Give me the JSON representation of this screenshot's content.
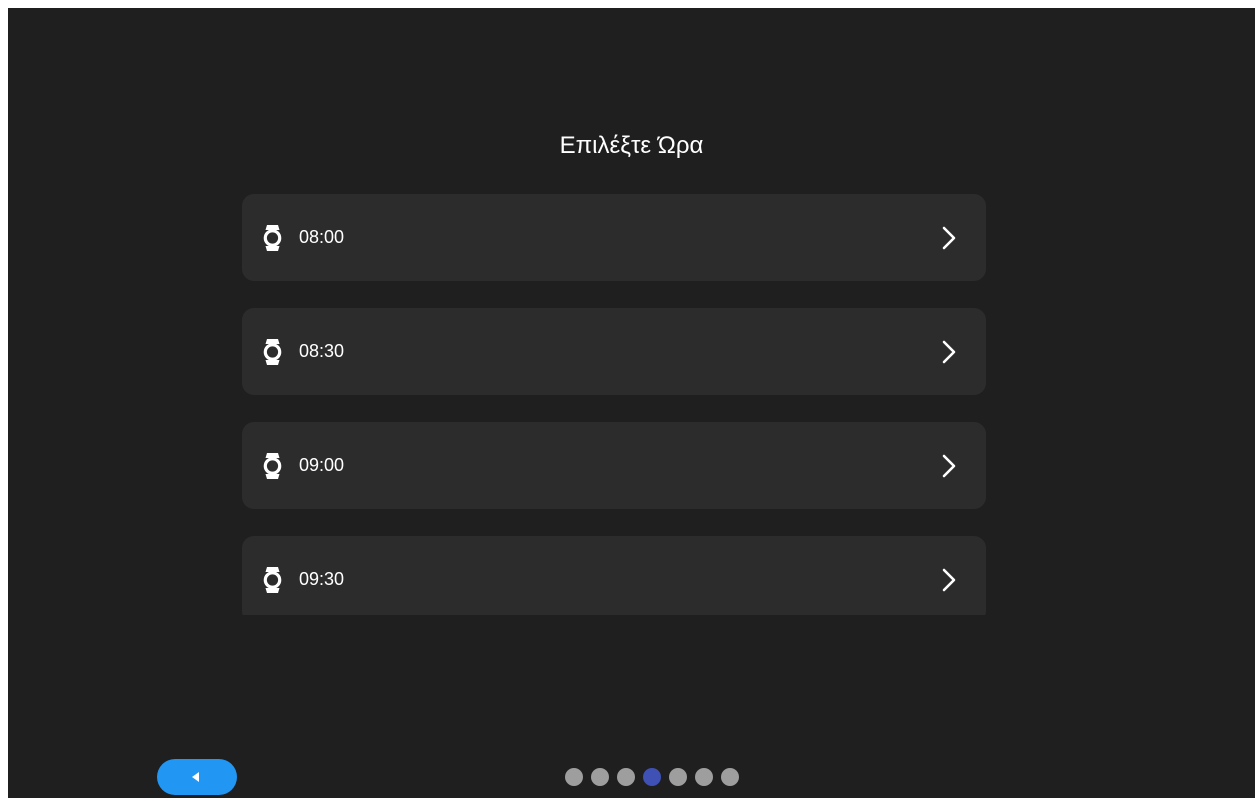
{
  "page": {
    "title": "Επιλέξτε Ώρα"
  },
  "times": [
    {
      "label": "08:00",
      "icon": "watch-icon"
    },
    {
      "label": "08:30",
      "icon": "watch-icon"
    },
    {
      "label": "09:00",
      "icon": "watch-icon"
    },
    {
      "label": "09:30",
      "icon": "watch-icon"
    }
  ],
  "back_button": {
    "icon": "triangle-left-icon"
  },
  "pager": {
    "total": 7,
    "active_index": 3
  },
  "colors": {
    "background": "#1f1f1f",
    "card": "#2c2c2c",
    "text": "#ffffff",
    "accent": "#2196f3",
    "dot_active": "#3f51b5",
    "dot_inactive": "#9e9e9e"
  }
}
